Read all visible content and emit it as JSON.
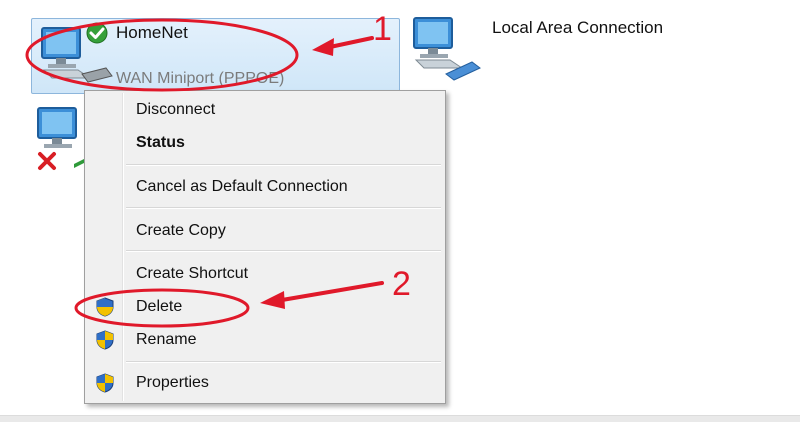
{
  "connections": [
    {
      "name": "HomeNet",
      "device": "WAN Miniport (PPPOE)"
    },
    {
      "name": "Local Area Connection"
    }
  ],
  "context_menu": {
    "items": [
      {
        "label": "Disconnect"
      },
      {
        "label": "Status"
      },
      {
        "label": "Cancel as Default Connection"
      },
      {
        "label": "Create Copy"
      },
      {
        "label": "Create Shortcut"
      },
      {
        "label": "Delete"
      },
      {
        "label": "Rename"
      },
      {
        "label": "Properties"
      }
    ]
  },
  "annotations": {
    "step1": "1",
    "step2": "2"
  },
  "colors": {
    "annotation": "#e0192a",
    "selection": "#cfe6f8",
    "menu_bg": "#f0f0f0",
    "shield_blue": "#2f6fc7",
    "shield_yellow": "#f2c100"
  },
  "icons": [
    "network-computer-icon",
    "connected-check-icon",
    "modem-icon",
    "disconnected-x-icon",
    "network-cable-icon",
    "uac-shield-icon"
  ]
}
